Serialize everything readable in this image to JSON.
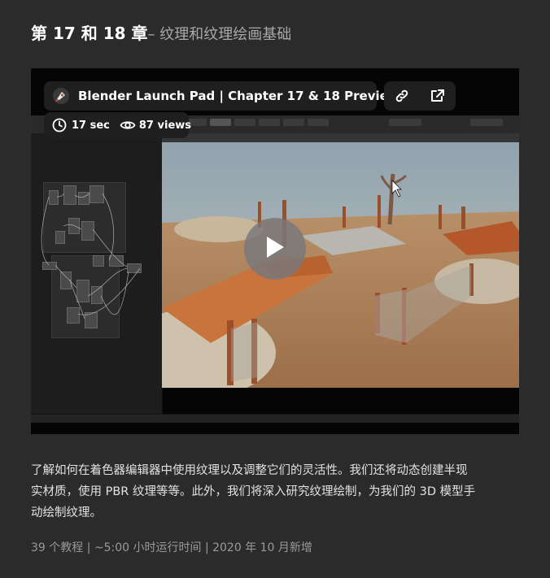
{
  "heading": {
    "chapter": "第 17 和 18 章",
    "subtitle": "– 纹理和纹理绘画基础"
  },
  "video": {
    "title": "Blender Launch Pad | Chapter 17 & 18 Preview",
    "duration": "17 sec",
    "views": "87 views",
    "icons": {
      "logo": "blender-launch-pad-logo-icon",
      "link": "link-icon",
      "external": "external-link-icon",
      "clock": "clock-icon",
      "eye": "eye-icon",
      "play": "play-icon"
    },
    "overlay_color": "#1f1f1f"
  },
  "description": {
    "line1": "了解如何在着色器编辑器中使用纹理以及调整它们的灵活性。我们还将动态创建半现",
    "line2": "实材质，使用 PBR 纹理等等。此外，我们将深入研究纹理绘制，为我们的 3D 模型手",
    "line3": "动绘制纹理。"
  },
  "footer": {
    "text": "39 个教程 | ~5:00 小时运行时间 | 2020 年 10 月新增"
  },
  "colors": {
    "page_bg": "#2b2b2b",
    "heading": "#ffffff",
    "muted": "#9a9a9a"
  }
}
